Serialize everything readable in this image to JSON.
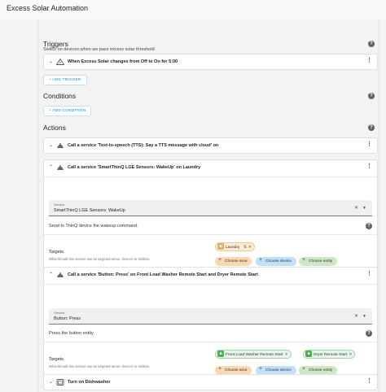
{
  "window": {
    "title": "Excess Solar Automation"
  },
  "description": "Switch on devices when we pass excess solar threshold",
  "triggers": {
    "title": "Triggers",
    "items": [
      {
        "label": "When Excess Solar changes from Off to On for 5:00"
      }
    ],
    "add_label": "+ ADD TRIGGER"
  },
  "conditions": {
    "title": "Conditions",
    "add_label": "+ ADD CONDITION"
  },
  "actions": {
    "title": "Actions",
    "tts": {
      "label": "Call a service 'Text-to-speech (TTS): Say a TTS message with cloud' on"
    },
    "smartthinq": {
      "label": "Call a service 'SmartThinQ LGE Sensors: WakeUp' on Laundry",
      "service_label": "Service",
      "service_value": "SmartThinQ LGE Sensors: WakeUp",
      "service_desc": "Send to ThinQ device the wakeup command.",
      "targets_title": "Targets",
      "targets_sub": "What should this service use as targeted areas, devices or entities.",
      "area_chip": "Laundry",
      "choose_area": "Choose area",
      "choose_device": "Choose device",
      "choose_entity": "Choose entity"
    },
    "button": {
      "label": "Call a service 'Button: Press' on Front Load Washer Remote Start and Dryer Remote Start",
      "service_label": "Service",
      "service_value": "Button: Press",
      "service_desc": "Press the button entity.",
      "targets_title": "Targets",
      "targets_sub": "What should this service use as targeted areas, devices or entities.",
      "entity_chip_1": "Front Load Washer Remote Start",
      "entity_chip_2": "Dryer Remote Start",
      "choose_area": "Choose area",
      "choose_device": "Choose device",
      "choose_entity": "Choose entity"
    },
    "dishwasher": {
      "label": "Turn on Dishwasher"
    }
  },
  "colors": {
    "accent": "#1e88e5",
    "area": "#fbd9b0",
    "device": "#bfe0f8",
    "entity": "#cfe8c4"
  }
}
